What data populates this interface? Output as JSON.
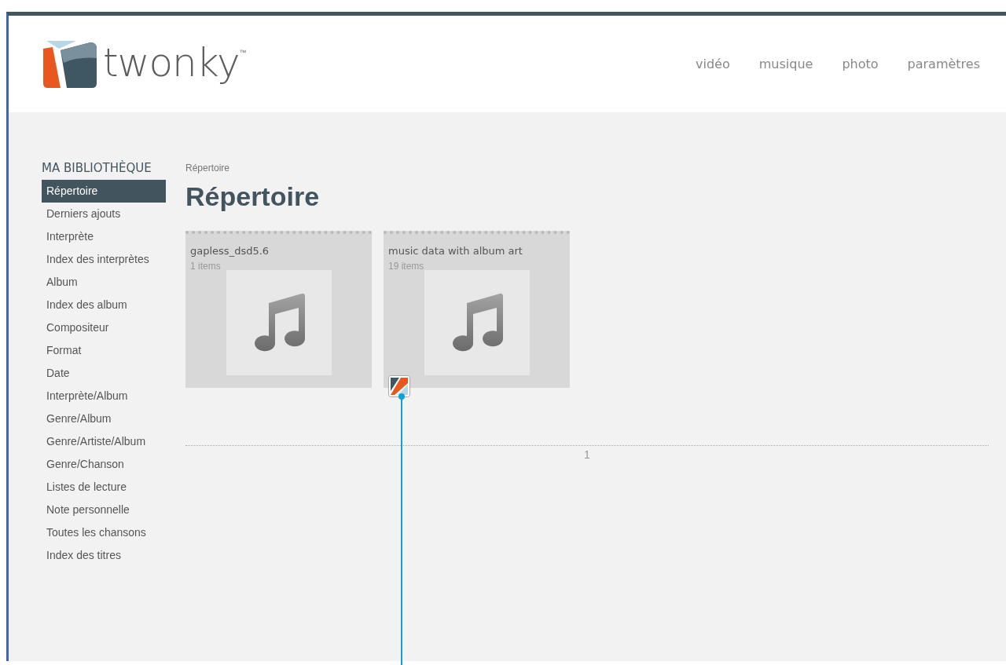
{
  "logo": {
    "wordmark": "twonky",
    "trademark": "™"
  },
  "nav": [
    {
      "label": "vidéo"
    },
    {
      "label": "musique"
    },
    {
      "label": "photo"
    },
    {
      "label": "paramètres"
    }
  ],
  "sidebar": {
    "title": "MA BIBLIOTHÈQUE",
    "items": [
      {
        "label": "Répertoire",
        "selected": true
      },
      {
        "label": "Derniers ajouts",
        "selected": false
      },
      {
        "label": "Interprète",
        "selected": false
      },
      {
        "label": "Index des interprètes",
        "selected": false
      },
      {
        "label": "Album",
        "selected": false
      },
      {
        "label": "Index des album",
        "selected": false
      },
      {
        "label": "Compositeur",
        "selected": false
      },
      {
        "label": "Format",
        "selected": false
      },
      {
        "label": "Date",
        "selected": false
      },
      {
        "label": "Interprète/Album",
        "selected": false
      },
      {
        "label": "Genre/Album",
        "selected": false
      },
      {
        "label": "Genre/Artiste/Album",
        "selected": false
      },
      {
        "label": "Genre/Chanson",
        "selected": false
      },
      {
        "label": "Listes de lecture",
        "selected": false
      },
      {
        "label": "Note personnelle",
        "selected": false
      },
      {
        "label": "Toutes les chansons",
        "selected": false
      },
      {
        "label": "Index des titres",
        "selected": false
      }
    ]
  },
  "breadcrumb": "Répertoire",
  "heading": "Répertoire",
  "folders": [
    {
      "name": "gapless_dsd5.6",
      "count": "1 items",
      "badge": false
    },
    {
      "name": "music data with album art",
      "count": "19 items",
      "badge": true
    }
  ],
  "pagination": {
    "pages": [
      "1"
    ]
  }
}
